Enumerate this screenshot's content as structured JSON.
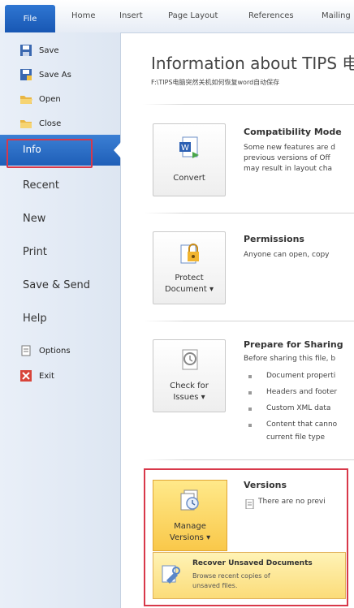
{
  "ribbon": {
    "file_tab": "File",
    "tabs": [
      "Home",
      "Insert",
      "Page Layout",
      "References",
      "Mailing"
    ]
  },
  "nav": {
    "save": "Save",
    "save_as": "Save As",
    "open": "Open",
    "close": "Close",
    "info": "Info",
    "recent": "Recent",
    "new": "New",
    "print": "Print",
    "save_send": "Save & Send",
    "help": "Help",
    "options": "Options",
    "exit": "Exit"
  },
  "main": {
    "title": "Information about TIPS 电",
    "path": "F:\\TIPS电脑突然关机如何恢复word自动保存",
    "compatibility": {
      "button": "Convert",
      "heading": "Compatibility Mode",
      "lines": [
        "Some new features are d",
        "previous versions of Off",
        "may result in layout cha"
      ]
    },
    "permissions": {
      "button_line1": "Protect",
      "button_line2": "Document ▾",
      "heading": "Permissions",
      "text": "Anyone can open, copy"
    },
    "sharing": {
      "button_line1": "Check for",
      "button_line2": "Issues ▾",
      "heading": "Prepare for Sharing",
      "text": "Before sharing this file, b",
      "bullets": [
        "Document properti",
        "Headers and footer",
        "Custom XML data",
        "Content that canno"
      ],
      "bullet_continuation": "current file type"
    },
    "versions": {
      "button_line1": "Manage",
      "button_line2": "Versions ▾",
      "heading": "Versions",
      "text": "There are no previ",
      "recover_title": "Recover Unsaved Documents",
      "recover_line1": "Browse recent copies of",
      "recover_line2": "unsaved files."
    }
  },
  "colors": {
    "file_tab": "#1f5fb8",
    "highlight": "#d8384a",
    "manage_fill": "#f9c84a"
  }
}
